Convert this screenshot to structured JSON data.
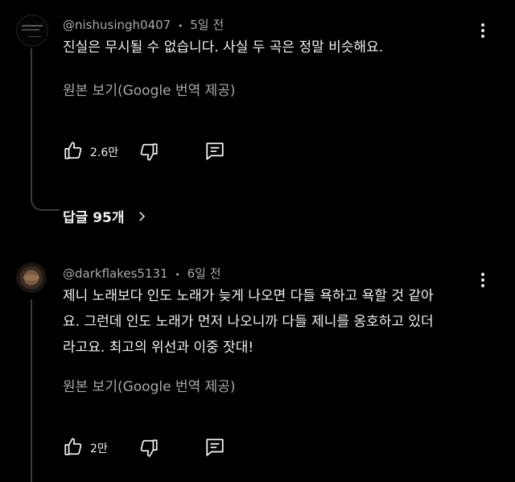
{
  "comments": [
    {
      "author": "@nishusingh0407",
      "separator": "•",
      "time": "5일 전",
      "lines": [
        "진실은 무시될 수 없습니다. 사실 두 곡은 정말 비슷해요."
      ],
      "translate_label": "원본 보기(Google 번역 제공)",
      "likes": "2.6만",
      "replies_label": "답글 95개"
    },
    {
      "author": "@darkflakes5131",
      "separator": "•",
      "time": "6일 전",
      "lines": [
        "제니 노래보다 인도 노래가 늦게 나오면 다들 욕하고 욕할 것 같아",
        "요. 그런데 인도 노래가 먼저 나오니까 다들 제니를 옹호하고 있더",
        "라고요. 최고의 위선과 이중 잣대!"
      ],
      "translate_label": "원본 보기(Google 번역 제공)",
      "likes": "2만"
    }
  ],
  "icons": {
    "like": "thumb-up-icon",
    "dislike": "thumb-down-icon",
    "reply": "comment-reply-icon",
    "more": "kebab-menu-icon",
    "chevron": "chevron-right-icon"
  }
}
